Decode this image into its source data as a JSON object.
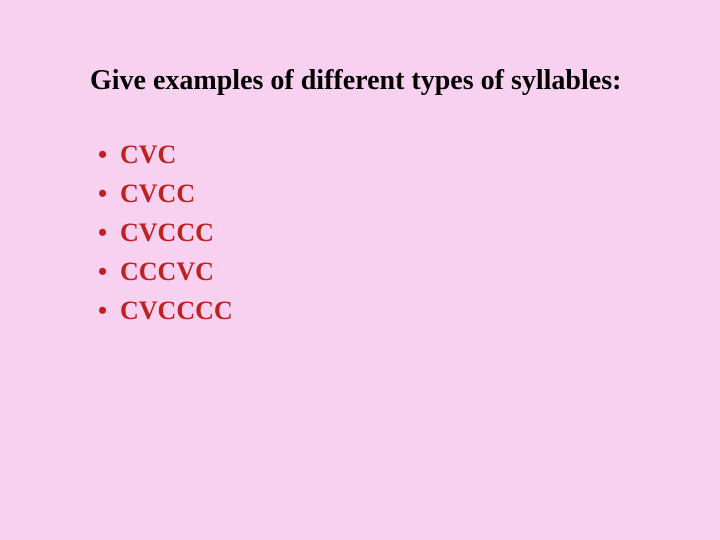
{
  "title": "Give examples of different types of syllables:",
  "items": [
    "CVC",
    "CVCC",
    "CVCCC",
    "CCCVC",
    "CVCCCC"
  ]
}
